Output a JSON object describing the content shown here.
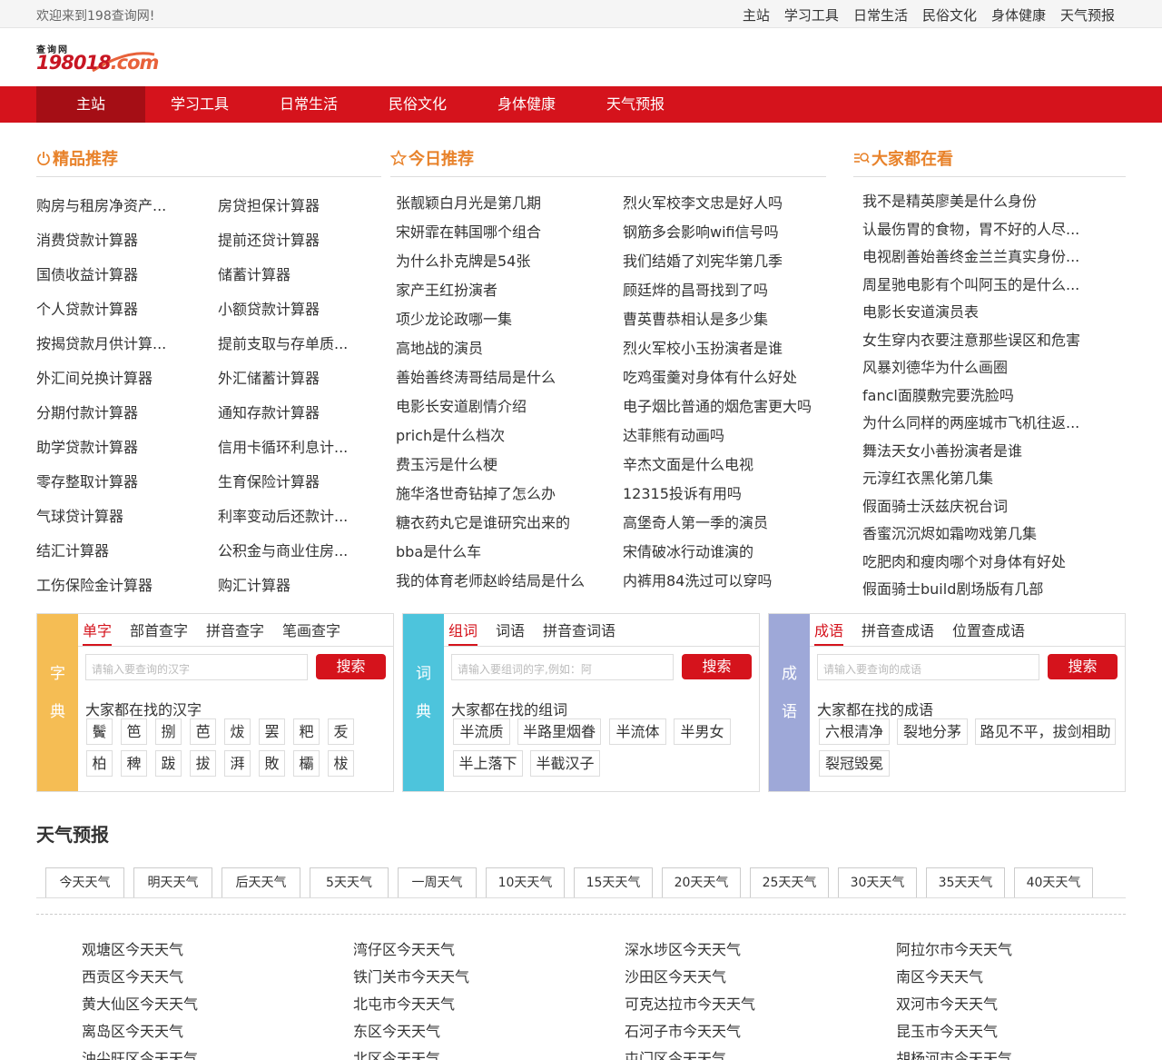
{
  "topbar": {
    "welcome": "欢迎来到198查询网!",
    "links": [
      "主站",
      "学习工具",
      "日常生活",
      "民俗文化",
      "身体健康",
      "天气预报"
    ]
  },
  "logo": {
    "small": "查询网",
    "main": "198018",
    "suffix": ".com"
  },
  "nav": [
    "主站",
    "学习工具",
    "日常生活",
    "民俗文化",
    "身体健康",
    "天气预报"
  ],
  "sections": {
    "jingpin": {
      "title": "精品推荐",
      "col1": [
        "购房与租房净资产...",
        "消费贷款计算器",
        "国债收益计算器",
        "个人贷款计算器",
        "按揭贷款月供计算...",
        "外汇间兑换计算器",
        "分期付款计算器",
        "助学贷款计算器",
        "零存整取计算器",
        "气球贷计算器",
        "结汇计算器",
        "工伤保险金计算器"
      ],
      "col2": [
        "房贷担保计算器",
        "提前还贷计算器",
        "储蓄计算器",
        "小额贷款计算器",
        "提前支取与存单质...",
        "外汇储蓄计算器",
        "通知存款计算器",
        "信用卡循环利息计...",
        "生育保险计算器",
        "利率变动后还款计...",
        "公积金与商业住房...",
        "购汇计算器"
      ]
    },
    "jinri": {
      "title": "今日推荐",
      "col1": [
        "张靓颖白月光是第几期",
        "宋妍霏在韩国哪个组合",
        "为什么扑克牌是54张",
        "家产王红扮演者",
        "项少龙论政哪一集",
        "高地战的演员",
        "善始善终涛哥结局是什么",
        "电影长安道剧情介绍",
        "prich是什么档次",
        "费玉污是什么梗",
        "施华洛世奇钻掉了怎么办",
        "糖衣药丸它是谁研究出来的",
        "bba是什么车",
        "我的体育老师赵岭结局是什么"
      ],
      "col2": [
        "烈火军校李文忠是好人吗",
        "钢筋多会影响wifi信号吗",
        "我们结婚了刘宪华第几季",
        "顾廷烨的昌哥找到了吗",
        "曹英曹恭相认是多少集",
        "烈火军校小玉扮演者是谁",
        "吃鸡蛋羹对身体有什么好处",
        "电子烟比普通的烟危害更大吗",
        "达菲熊有动画吗",
        "辛杰文面是什么电视",
        "12315投诉有用吗",
        "高堡奇人第一季的演员",
        "宋倩破冰行动谁演的",
        "内裤用84洗过可以穿吗"
      ]
    },
    "dajia": {
      "title": "大家都在看",
      "items": [
        "我不是精英廖美是什么身份",
        "认最伤胃的食物，胃不好的人尽...",
        "电视剧善始善终金兰兰真实身份...",
        "周星驰电影有个叫阿玉的是什么...",
        "电影长安道演员表",
        "女生穿内衣要注意那些误区和危害",
        "风暴刘德华为什么画圈",
        "fancl面膜敷完要洗脸吗",
        "为什么同样的两座城市飞机往返...",
        "舞法天女小善扮演者是谁",
        "元淳红衣黑化第几集",
        "假面骑士沃兹庆祝台词",
        "香蜜沉沉烬如霜吻戏第几集",
        "吃肥肉和瘦肉哪个对身体有好处",
        "假面骑士build剧场版有几部"
      ]
    }
  },
  "dict": {
    "zidian": {
      "side": [
        "字",
        "典"
      ],
      "tabs": [
        "单字",
        "部首查字",
        "拼音查字",
        "笔画查字"
      ],
      "placeholder": "请输入要查询的汉字",
      "button": "搜索",
      "label": "大家都在找的汉字",
      "chips": [
        "鬢",
        "笆",
        "捌",
        "芭",
        "炦",
        "罢",
        "粑",
        "叐",
        "柏",
        "稗",
        "跋",
        "拔",
        "湃",
        "敗",
        "欛",
        "柭"
      ]
    },
    "cidian": {
      "side": [
        "词",
        "典"
      ],
      "tabs": [
        "组词",
        "词语",
        "拼音查词语"
      ],
      "placeholder": "请输入要组词的字,例如：阿",
      "button": "搜索",
      "label": "大家都在找的组词",
      "chips": [
        "半流质",
        "半路里烟眷",
        "半流体",
        "半男女",
        "半上落下",
        "半截汉子"
      ]
    },
    "chengyu": {
      "side": [
        "成",
        "语"
      ],
      "tabs": [
        "成语",
        "拼音查成语",
        "位置查成语"
      ],
      "placeholder": "请输入要查询的成语",
      "button": "搜索",
      "label": "大家都在找的成语",
      "chips": [
        "六根清净",
        "裂地分茅",
        "路见不平，拔剑相助",
        "裂冠毁冕"
      ]
    }
  },
  "weather": {
    "title": "天气预报",
    "tabs": [
      "今天天气",
      "明天天气",
      "后天天气",
      "5天天气",
      "一周天气",
      "10天天气",
      "15天天气",
      "20天天气",
      "25天天气",
      "30天天气",
      "35天天气",
      "40天天气"
    ],
    "cities": [
      [
        "观塘区今天天气",
        "西贡区今天天气",
        "黄大仙区今天天气",
        "离岛区今天天气",
        "油尖旺区今天天气"
      ],
      [
        "湾仔区今天天气",
        "铁门关市今天天气",
        "北屯市今天天气",
        "东区今天天气",
        "北区今天天气"
      ],
      [
        "深水埗区今天天气",
        "沙田区今天天气",
        "可克达拉市今天天气",
        "石河子市今天天气",
        "屯门区今天天气"
      ],
      [
        "阿拉尔市今天天气",
        "南区今天天气",
        "双河市今天天气",
        "昆玉市今天天气",
        "胡杨河市今天天气"
      ]
    ]
  },
  "colors": {
    "brand_red": "#d5131c",
    "nav_active": "#a50e15",
    "section_orange": "#e8822a",
    "zidian_side": "#f5bd54",
    "cidian_side": "#4dc4dc",
    "chengyu_side": "#9ea8d8"
  }
}
